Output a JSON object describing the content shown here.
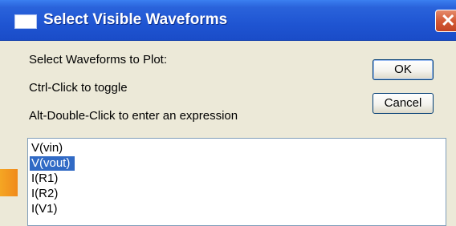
{
  "window": {
    "title": "Select Visible Waveforms",
    "title_icon": "window-icon",
    "close_icon": "close-icon",
    "close_glyph": "✕"
  },
  "instructions": {
    "line1": "Select Waveforms to Plot:",
    "line2": "Ctrl-Click to toggle",
    "line3": "Alt-Double-Click to enter an expression"
  },
  "buttons": {
    "ok": "OK",
    "cancel": "Cancel"
  },
  "waveforms": {
    "items": [
      "V(vin)",
      "V(vout)",
      "I(R1)",
      "I(R2)",
      "I(V1)"
    ],
    "selected": "V(vout)"
  },
  "colors": {
    "titlebar": "#2a63db",
    "selection": "#316ac5",
    "dialog_bg": "#ece9d8"
  }
}
